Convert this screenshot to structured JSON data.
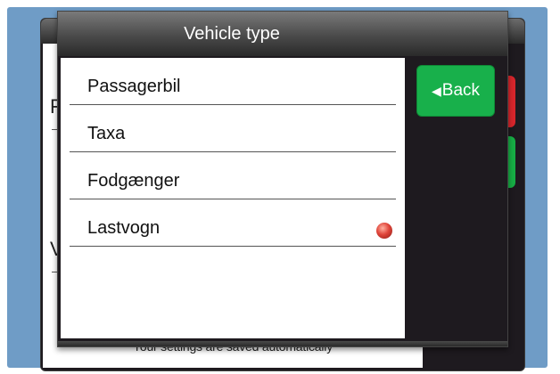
{
  "dialog": {
    "title": "Vehicle type",
    "back_button": {
      "arrow_icon": "left-triangle-icon",
      "label": "Back"
    },
    "items": [
      {
        "label": "Passagerbil",
        "selected": false
      },
      {
        "label": "Taxa",
        "selected": false
      },
      {
        "label": "Fodgænger",
        "selected": false
      },
      {
        "label": "Lastvogn",
        "selected": true
      }
    ],
    "accent_color": "#18b04b",
    "selected_indicator_color": "#e0453a"
  },
  "background_window": {
    "partial_letters": [
      "F",
      "V"
    ],
    "footer": "Your settings are saved automatically"
  }
}
